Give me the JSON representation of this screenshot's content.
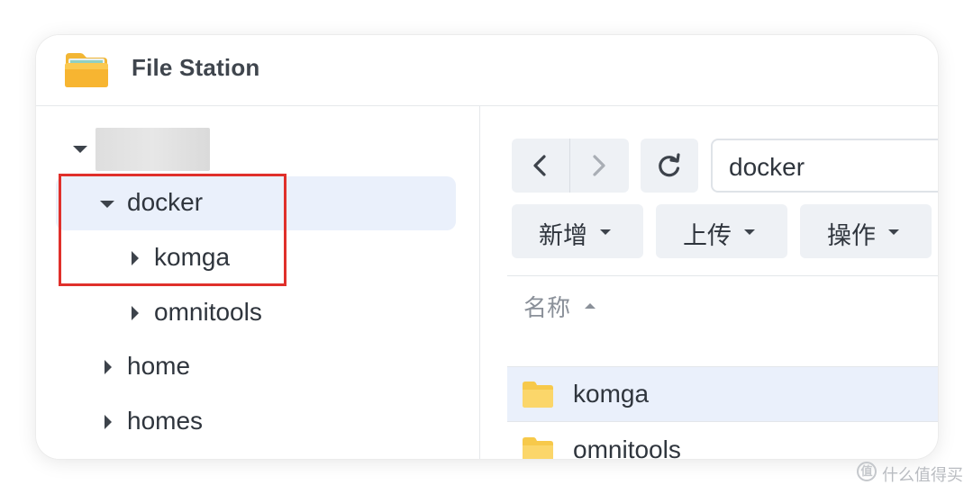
{
  "app": {
    "title": "File Station"
  },
  "sidebar": {
    "root_label": "",
    "items": [
      {
        "label": "docker",
        "expanded": true,
        "selected": true
      },
      {
        "label": "komga",
        "expanded": false
      },
      {
        "label": "omnitools",
        "expanded": false
      },
      {
        "label": "home",
        "expanded": false
      },
      {
        "label": "homes",
        "expanded": false
      }
    ]
  },
  "toolbar": {
    "path": "docker",
    "create_label": "新增",
    "upload_label": "上传",
    "action_label": "操作"
  },
  "file_list": {
    "column_name": "名称",
    "rows": [
      {
        "name": "komga",
        "type": "folder",
        "selected": true
      },
      {
        "name": "omnitools",
        "type": "folder",
        "selected": false
      }
    ]
  },
  "watermark": {
    "text": "什么值得买"
  },
  "colors": {
    "accent_selection": "#eaf0fb",
    "highlight_box": "#e0302b",
    "folder": "#f7c94a"
  }
}
